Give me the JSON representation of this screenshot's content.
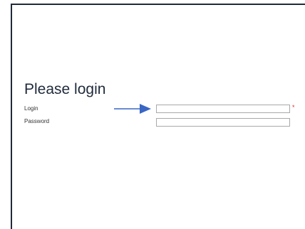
{
  "login_form": {
    "title": "Please login",
    "login_label": "Login",
    "login_value": "",
    "login_required_marker": "*",
    "password_label": "Password",
    "password_value": ""
  },
  "colors": {
    "frame_border": "#1f2a3a",
    "title_text": "#1f2a3a",
    "required_marker": "#e0302a",
    "annotation_arrow": "#3a66c4",
    "input_border": "#a9a9a9"
  },
  "icons": {
    "annotation": "arrow-right-icon"
  }
}
